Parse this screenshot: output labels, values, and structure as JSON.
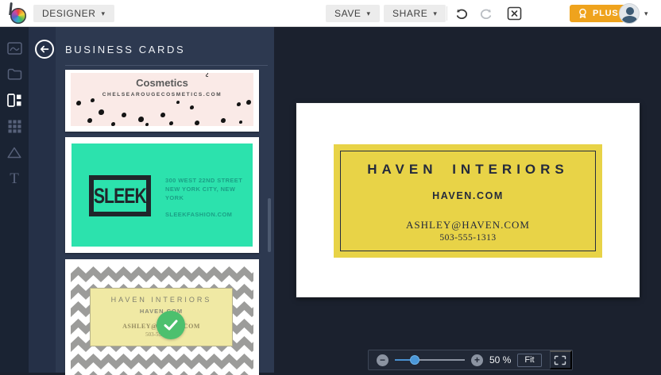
{
  "topbar": {
    "designer_label": "DESIGNER",
    "save_label": "SAVE",
    "share_label": "SHARE",
    "plus_label": "PLUS"
  },
  "icons": {
    "caret_down": "▾",
    "minus": "−",
    "plus": "+"
  },
  "sidebar": {
    "items": [
      {
        "label": "image"
      },
      {
        "label": "folder"
      },
      {
        "label": "templates",
        "active": true
      },
      {
        "label": "elements-grid"
      },
      {
        "label": "shapes"
      },
      {
        "label": "text"
      }
    ]
  },
  "panel": {
    "title": "BUSINESS CARDS",
    "templates": [
      {
        "name": "cosmetics-template",
        "brand": "Cosmetics",
        "website": "CHELSEAROUGECOSMETICS.COM",
        "dots": [
          [
            3,
            22,
            6
          ],
          [
            11,
            16,
            5
          ],
          [
            15,
            50,
            7
          ],
          [
            9,
            76,
            6
          ],
          [
            22,
            88,
            5
          ],
          [
            28,
            58,
            6
          ],
          [
            37,
            72,
            7
          ],
          [
            41,
            90,
            4
          ],
          [
            49,
            58,
            6
          ],
          [
            54,
            86,
            5
          ],
          [
            65,
            38,
            5
          ],
          [
            68,
            82,
            6
          ],
          [
            82,
            76,
            6
          ],
          [
            91,
            28,
            5
          ],
          [
            96,
            20,
            6
          ],
          [
            92,
            84,
            4
          ],
          [
            58,
            24,
            4
          ]
        ]
      },
      {
        "name": "sleek-template",
        "logo": "SLEEK",
        "address_line1": "300 WEST 22ND STREET",
        "address_line2": "NEW YORK CITY, NEW YORK",
        "website": "SLEEKFASHION.COM"
      },
      {
        "name": "haven-template",
        "selected": true,
        "company": "HAVEN INTERIORS",
        "website": "HAVEN.COM",
        "email": "ASHLEY@HAVEN.COM",
        "phone": "503-555-1313"
      }
    ]
  },
  "canvas": {
    "card": {
      "company": "HAVEN INTERIORS",
      "website": "HAVEN.COM",
      "email": "ASHLEY@HAVEN.COM",
      "phone": "503-555-1313"
    }
  },
  "zoombar": {
    "zoom_value": "50 %",
    "fit_label": "Fit"
  },
  "colors": {
    "accent_teal": "#2ce2ad",
    "card_yellow": "#e8d347",
    "plus_orange": "#efa31d",
    "selected_green": "#4cc06e",
    "slider_blue": "#4a90d0"
  }
}
